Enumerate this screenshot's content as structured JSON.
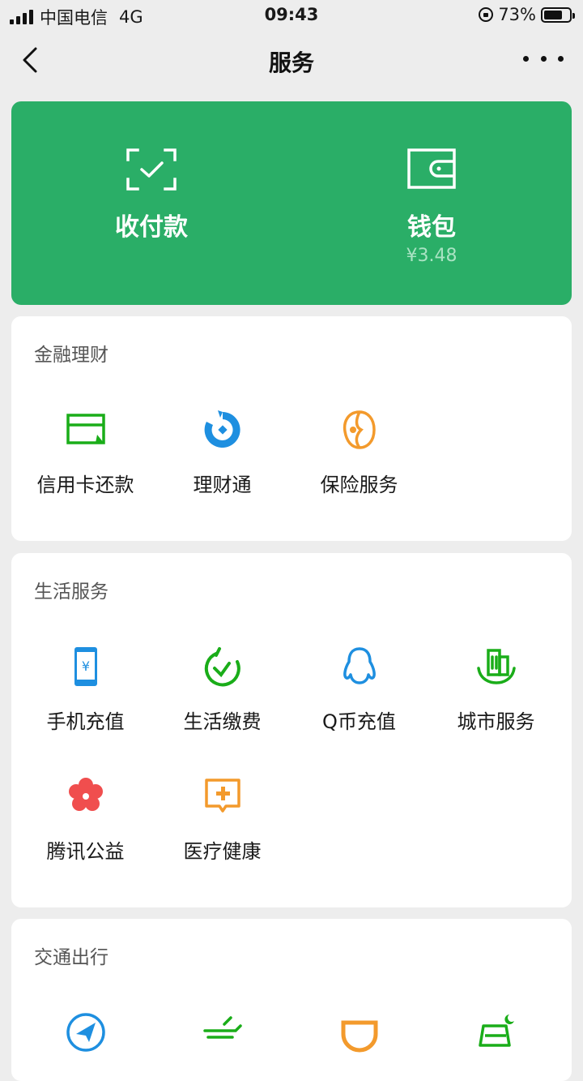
{
  "status_bar": {
    "carrier": "中国电信",
    "network": "4G",
    "time": "09:43",
    "battery": "73%",
    "battery_level": 0.73
  },
  "navbar": {
    "title": "服务"
  },
  "wallet_card": {
    "background": "#2aae67",
    "pay": {
      "label": "收付款",
      "icon": "scan-check-icon"
    },
    "wallet": {
      "label": "钱包",
      "balance": "¥3.48",
      "icon": "wallet-icon"
    }
  },
  "sections": {
    "finance": {
      "title": "金融理财",
      "items": [
        {
          "label": "信用卡还款",
          "icon": "credit-card-icon",
          "color": "#1aad19"
        },
        {
          "label": "理财通",
          "icon": "licaitong-icon",
          "color": "#1e8fe0"
        },
        {
          "label": "保险服务",
          "icon": "insurance-icon",
          "color": "#f39a2c"
        }
      ]
    },
    "life": {
      "title": "生活服务",
      "items": [
        {
          "label": "手机充值",
          "icon": "phone-recharge-icon",
          "color": "#1e8fe0"
        },
        {
          "label": "生活缴费",
          "icon": "bill-payment-icon",
          "color": "#1aad19"
        },
        {
          "label": "Q币充值",
          "icon": "qq-penguin-icon",
          "color": "#1e8fe0"
        },
        {
          "label": "城市服务",
          "icon": "city-service-icon",
          "color": "#1aad19"
        },
        {
          "label": "腾讯公益",
          "icon": "charity-flower-icon",
          "color": "#f04e4e"
        },
        {
          "label": "医疗健康",
          "icon": "medical-icon",
          "color": "#f39a2c"
        }
      ]
    },
    "transport": {
      "title": "交通出行",
      "items": [
        {
          "icon": "navigation-icon",
          "color": "#1e8fe0"
        },
        {
          "icon": "flight-train-icon",
          "color": "#1aad19"
        },
        {
          "icon": "didi-icon",
          "color": "#f39a2c"
        },
        {
          "icon": "hotel-icon",
          "color": "#1aad19"
        }
      ]
    }
  }
}
